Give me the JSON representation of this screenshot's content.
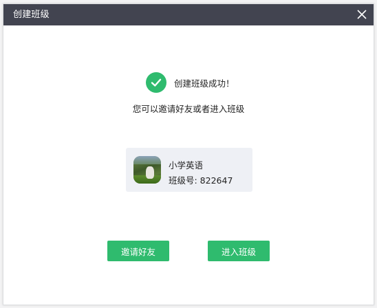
{
  "dialog": {
    "title": "创建班级"
  },
  "success": {
    "message": "创建班级成功！",
    "hint": "您可以邀请好友或者进入班级"
  },
  "class_card": {
    "name": "小学英语",
    "number_label": "班级号: 822647"
  },
  "actions": {
    "invite_label": "邀请好友",
    "enter_label": "进入班级"
  },
  "colors": {
    "titlebar": "#424450",
    "accent": "#2fbb6e",
    "card_bg": "#eef0f5"
  },
  "icons": {
    "close": "close-icon",
    "success": "check-circle-icon"
  }
}
